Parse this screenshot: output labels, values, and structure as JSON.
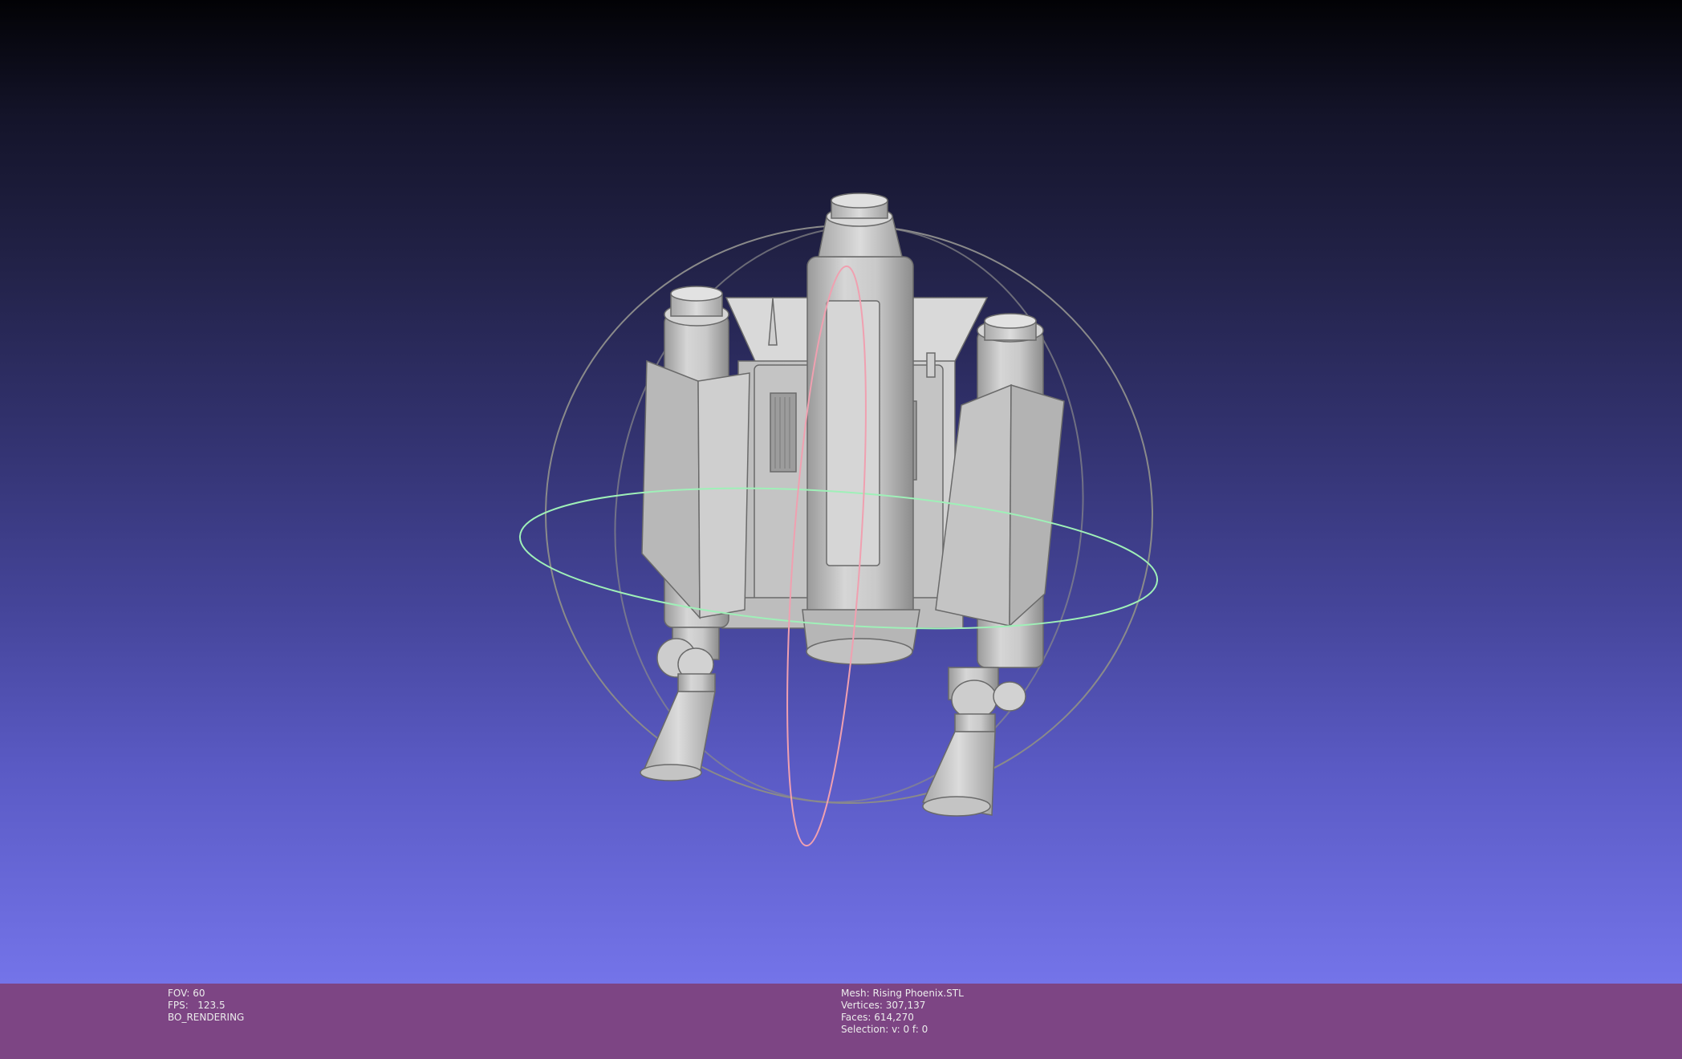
{
  "viewport": {
    "background_top": "#020205",
    "background_bottom": "#7474e9",
    "model_color": "#c8c8c8",
    "trackball": {
      "ring_horizontal_color": "#9ff0b8",
      "ring_vertical_color": "#f0a0b0",
      "ring_outline_color": "#8a8a8a"
    }
  },
  "status": {
    "left": {
      "fov": "FOV: 60",
      "fps": "FPS:   123.5",
      "mode": "BO_RENDERING"
    },
    "right": {
      "mesh": "Mesh: Rising Phoenix.STL",
      "vertices": "Vertices: 307,137",
      "faces": "Faces: 614,270",
      "selection": "Selection: v: 0 f: 0"
    }
  },
  "colors": {
    "statusbar": "#7d4584",
    "status_text": "#ececec"
  }
}
